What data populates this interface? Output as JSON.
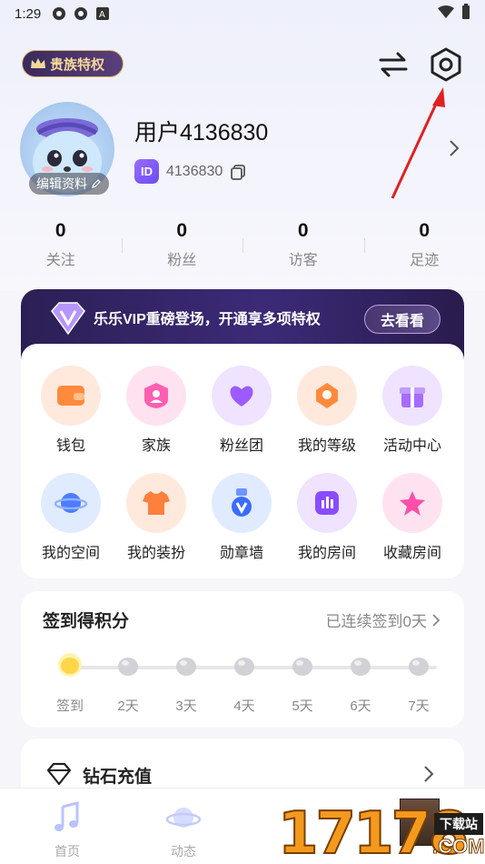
{
  "status_bar": {
    "time": "1:29"
  },
  "header": {
    "noble_badge": "贵族特权"
  },
  "profile": {
    "username": "用户4136830",
    "id_badge": "ID",
    "id_value": "4136830",
    "edit_label": "编辑资料"
  },
  "stats": [
    {
      "value": "0",
      "label": "关注"
    },
    {
      "value": "0",
      "label": "粉丝"
    },
    {
      "value": "0",
      "label": "访客"
    },
    {
      "value": "0",
      "label": "足迹"
    }
  ],
  "vip": {
    "text": "乐乐VIP重磅登场，开通享多项特权",
    "button": "去看看"
  },
  "grid": [
    {
      "label": "钱包",
      "icon": "wallet-icon",
      "color": "#ff8a3d"
    },
    {
      "label": "家族",
      "icon": "family-icon",
      "color": "#ff5fb0"
    },
    {
      "label": "粉丝团",
      "icon": "heart-icon",
      "color": "#9b5bff"
    },
    {
      "label": "我的等级",
      "icon": "level-medal-icon",
      "color": "#ff8a3d"
    },
    {
      "label": "活动中心",
      "icon": "gift-icon",
      "color": "#a76bff"
    },
    {
      "label": "我的空间",
      "icon": "planet-icon",
      "color": "#4c7dff"
    },
    {
      "label": "我的装扮",
      "icon": "tshirt-icon",
      "color": "#ff7f3d"
    },
    {
      "label": "勋章墙",
      "icon": "badge-v-icon",
      "color": "#3b6bff"
    },
    {
      "label": "我的房间",
      "icon": "room-chart-icon",
      "color": "#8a4cff"
    },
    {
      "label": "收藏房间",
      "icon": "star-icon",
      "color": "#ff4fa8"
    }
  ],
  "sign_in": {
    "title": "签到得积分",
    "status": "已连续签到0天",
    "days": [
      "签到",
      "2天",
      "3天",
      "4天",
      "5天",
      "6天",
      "7天"
    ]
  },
  "diamond": {
    "label": "钻石充值"
  },
  "bottom_nav": [
    {
      "label": "首页",
      "icon": "music-note-icon"
    },
    {
      "label": "动态",
      "icon": "planet-dynamic-icon"
    }
  ],
  "watermark": {
    "number": "17178",
    "download": "下载站",
    "domain": ".COM"
  }
}
